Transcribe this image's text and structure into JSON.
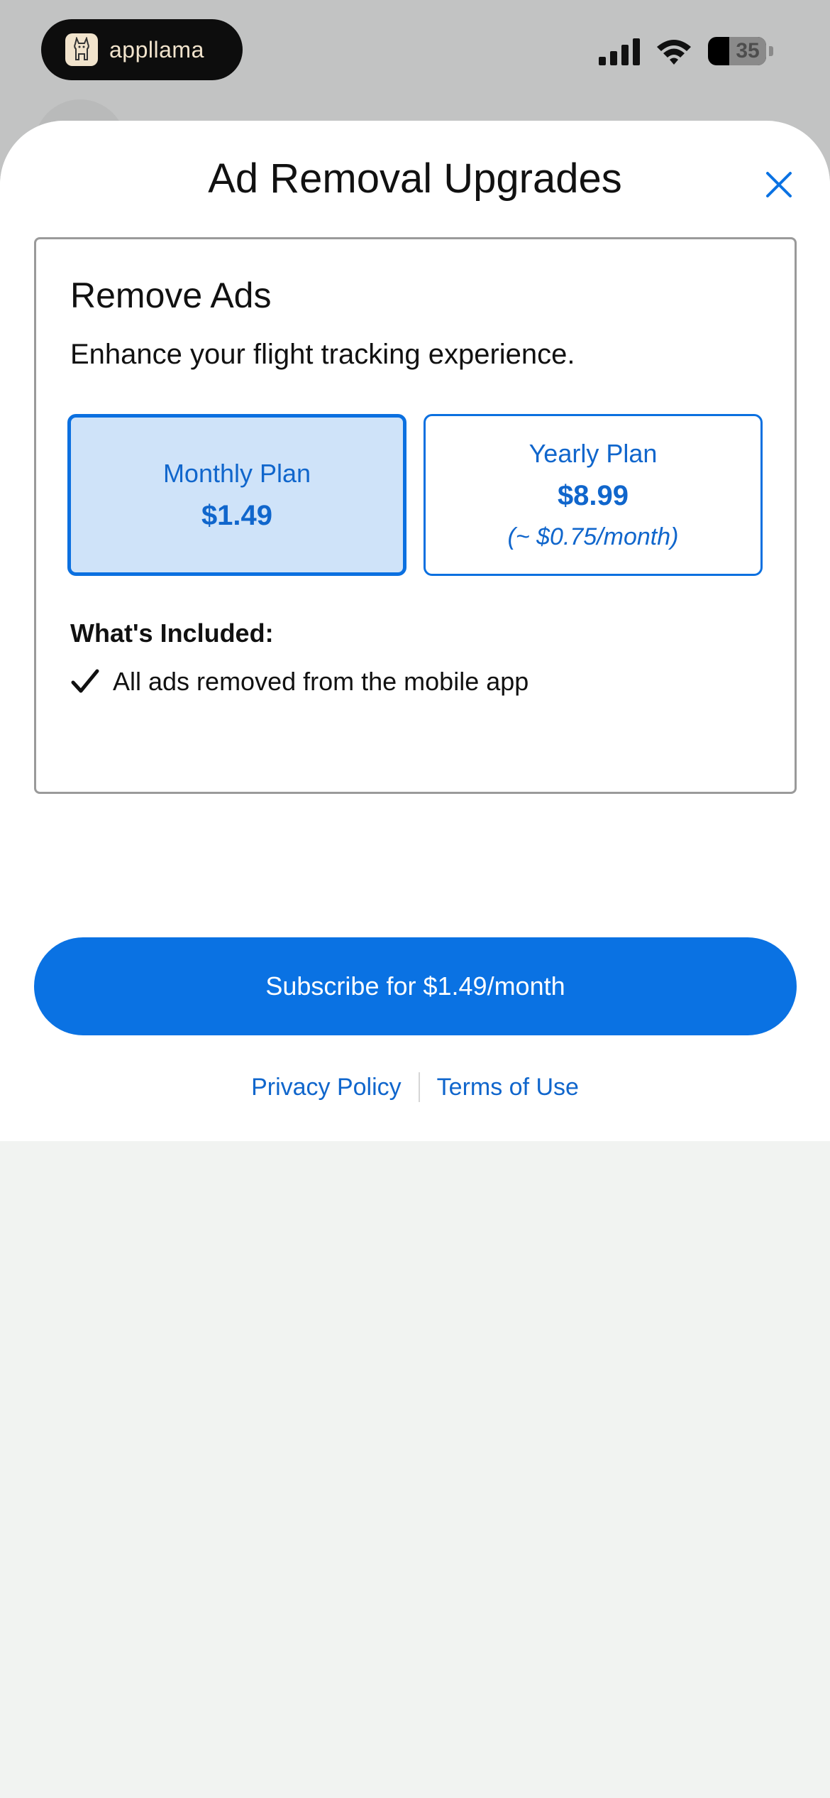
{
  "status_bar": {
    "brand_name": "appllama",
    "battery": "35",
    "icons": [
      "llama-logo-icon",
      "signal-icon",
      "wifi-icon",
      "battery-icon"
    ]
  },
  "sheet": {
    "title": "Ad Removal Upgrades",
    "close_icon": "close-icon"
  },
  "card": {
    "title": "Remove Ads",
    "subtitle": "Enhance your flight tracking experience.",
    "plans": [
      {
        "name": "Monthly Plan",
        "price": "$1.49",
        "note": "",
        "selected": true
      },
      {
        "name": "Yearly Plan",
        "price": "$8.99",
        "note": "(~ $0.75/month)",
        "selected": false
      }
    ],
    "included_title": "What's Included:",
    "features": [
      "All ads removed from the mobile app"
    ]
  },
  "subscribe_label": "Subscribe for $1.49/month",
  "links": {
    "privacy": "Privacy Policy",
    "terms": "Terms of Use"
  },
  "colors": {
    "accent": "#0a72e3",
    "selected_bg": "#cfe3f9",
    "link": "#1066cc"
  }
}
